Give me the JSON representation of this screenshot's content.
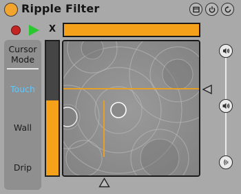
{
  "window": {
    "title": "Ripple Filter",
    "buttons": [
      {
        "name": "layout-icon"
      },
      {
        "name": "power-icon"
      },
      {
        "name": "refresh-icon"
      }
    ]
  },
  "transport": {
    "record_icon": "record-icon",
    "play_icon": "play-icon",
    "x_label": "X",
    "x_value_fraction": 1.0
  },
  "cursor_mode": {
    "title_line1": "Cursor",
    "title_line2": "Mode",
    "options": [
      "Touch",
      "Wall",
      "Drip"
    ],
    "selected": "Touch"
  },
  "meter": {
    "level_fraction": 0.56
  },
  "pad": {
    "crosshair_color": "#f0a21a"
  },
  "right_slider": {
    "icons": [
      "wave-top-icon",
      "wave-middle-icon",
      "wave-bottom-icon"
    ],
    "selected_index": 1
  },
  "colors": {
    "accent": "#f6a11a",
    "panel_bg": "#a9a9a9",
    "active_mode": "#5ec8ff",
    "record": "#c42424",
    "play": "#29c82e"
  }
}
